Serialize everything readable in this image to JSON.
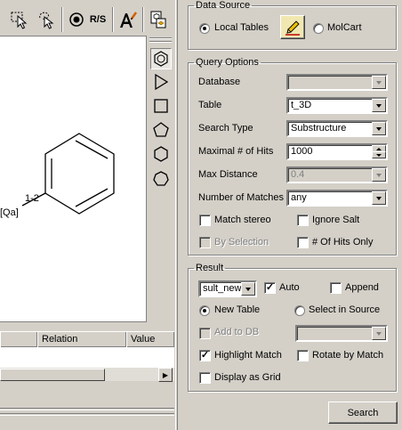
{
  "toolbar": {
    "buttons": [
      {
        "icon": "select-arrow-icon"
      },
      {
        "icon": "lasso-select-icon"
      },
      {
        "icon": "stereo-center-icon",
        "label": "R/S"
      },
      {
        "icon": "text-tool-icon"
      },
      {
        "icon": "template-tool-icon"
      }
    ]
  },
  "side_tools": [
    {
      "icon": "benzene-ring-icon",
      "active": true
    },
    {
      "icon": "triangle-ring-icon"
    },
    {
      "icon": "square-ring-icon"
    },
    {
      "icon": "pentagon-ring-icon"
    },
    {
      "icon": "hexagon-ring-icon"
    },
    {
      "icon": "heptagon-ring-icon"
    }
  ],
  "molecule": {
    "attachment_label": "[Qa]",
    "bond_label": "1-2"
  },
  "result_table": {
    "columns": [
      "",
      "Relation",
      "Value"
    ]
  },
  "data_source": {
    "legend": "Data Source",
    "local_tables_label": "Local Tables",
    "local_tables_selected": true,
    "molcart_label": "MolCart",
    "edit_icon": "pencil-icon"
  },
  "query_options": {
    "legend": "Query Options",
    "database_label": "Database",
    "database_value": "",
    "table_label": "Table",
    "table_value": "t_3D",
    "search_type_label": "Search Type",
    "search_type_value": "Substructure",
    "max_hits_label": "Maximal # of Hits",
    "max_hits_value": "1000",
    "max_distance_label": "Max Distance",
    "max_distance_value": "0.4",
    "num_matches_label": "Number of Matches",
    "num_matches_value": "any",
    "match_stereo_label": "Match stereo",
    "ignore_salt_label": "Ignore Salt",
    "by_selection_label": "By Selection",
    "hits_only_label": "# Of Hits Only"
  },
  "result": {
    "legend": "Result",
    "result_name_value": "sult_new",
    "auto_label": "Auto",
    "auto_checked": true,
    "append_label": "Append",
    "new_table_label": "New Table",
    "select_in_source_label": "Select in Source",
    "add_to_db_label": "Add to DB",
    "highlight_match_label": "Highlight Match",
    "highlight_match_checked": true,
    "rotate_by_match_label": "Rotate by Match",
    "display_as_grid_label": "Display as Grid"
  },
  "search_button_label": "Search",
  "colors": {
    "face": "#d4d0c8",
    "pencil_bg": "#f0e8b0"
  }
}
